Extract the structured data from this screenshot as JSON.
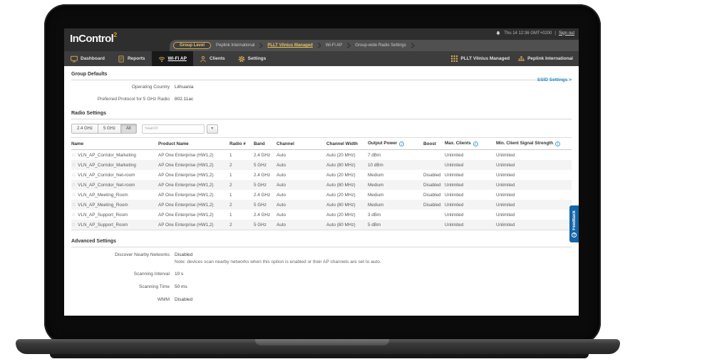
{
  "colors": {
    "accent_gold": "#d2a94f",
    "breadcrumb_active": "#e3c45c",
    "logo_sup_orange": "#e8941f",
    "link_blue": "#1e88c7",
    "info_blue": "#42a5d6",
    "feedback_blue": "#1565a8",
    "header_bg": "#2e2e2e",
    "nav_bg": "#3d3d3d",
    "nav_active_bg": "#191919",
    "row_stripe": "#f4f4f4"
  },
  "icons": {
    "star": "☆",
    "caret_down": "▾",
    "info": "i",
    "feedback": "?"
  },
  "header": {
    "logo_text": "InControl",
    "logo_sup": "2",
    "status": {
      "time": "Thu 14 12:36 GMT+0200",
      "separator": "|",
      "sign_out": "Sign out"
    },
    "breadcrumb": {
      "group_level_label": "Group Level",
      "items": [
        {
          "label": "Peplink International",
          "active": false
        },
        {
          "label": "PLLT Vilnius Managed",
          "active": true
        },
        {
          "label": "Wi-Fi AP",
          "active": false
        },
        {
          "label": "Group-wide Radio Settings",
          "active": false
        }
      ]
    },
    "nav": {
      "items": [
        {
          "icon": "dashboard-icon",
          "label": "Dashboard",
          "active": false
        },
        {
          "icon": "reports-icon",
          "label": "Reports",
          "active": false
        },
        {
          "icon": "wifi-icon",
          "label": "Wi-Fi AP",
          "active": true
        },
        {
          "icon": "clients-icon",
          "label": "Clients",
          "active": false
        },
        {
          "icon": "settings-icon",
          "label": "Settings",
          "active": false
        }
      ],
      "context": [
        {
          "icon": "grid-icon",
          "label": "PLLT Vilnius Managed"
        },
        {
          "icon": "org-icon",
          "label": "Peplink International"
        }
      ]
    }
  },
  "main": {
    "ssid_settings_link": "SSID Settings >",
    "group_defaults": {
      "title": "Group Defaults",
      "fields": [
        {
          "label": "Operating Country",
          "value": "Lithuania"
        },
        {
          "label": "Preferred Protocol for 5 GHz Radio",
          "value": "802.11ac"
        }
      ]
    },
    "radio_settings": {
      "title": "Radio Settings",
      "band_tabs": [
        {
          "label": "2.4 GHz",
          "active": false
        },
        {
          "label": "5 GHz",
          "active": false
        },
        {
          "label": "All",
          "active": true
        }
      ],
      "search_placeholder": "Search",
      "table": {
        "columns": [
          {
            "label": "Name",
            "info": false
          },
          {
            "label": "Product Name",
            "info": false
          },
          {
            "label": "Radio #",
            "info": false
          },
          {
            "label": "Band",
            "info": false
          },
          {
            "label": "Channel",
            "info": false
          },
          {
            "label": "Channel Width",
            "info": false
          },
          {
            "label": "Output Power",
            "info": true
          },
          {
            "label": "Boost",
            "info": false
          },
          {
            "label": "Max. Clients",
            "info": true
          },
          {
            "label": "Min. Client Signal Strength",
            "info": true
          }
        ],
        "rows": [
          {
            "cells": [
              "VLN_AP_Corridor_Marketing",
              "AP One Enterprise (HW1,2)",
              "1",
              "2.4 GHz",
              "Auto",
              "Auto (20 MHz)",
              "7 dBm",
              "",
              "Unlimited",
              "Unlimited"
            ]
          },
          {
            "cells": [
              "VLN_AP_Corridor_Marketing",
              "AP One Enterprise (HW1,2)",
              "2",
              "5 GHz",
              "Auto",
              "Auto (80 MHz)",
              "10 dBm",
              "",
              "Unlimited",
              "Unlimited"
            ]
          },
          {
            "cells": [
              "VLN_AP_Corridor_Net-room",
              "AP One Enterprise (HW1,2)",
              "1",
              "2.4 GHz",
              "Auto",
              "Auto (20 MHz)",
              "Medium",
              "Disabled",
              "Unlimited",
              "Unlimited"
            ]
          },
          {
            "cells": [
              "VLN_AP_Corridor_Net-room",
              "AP One Enterprise (HW1,2)",
              "2",
              "5 GHz",
              "Auto",
              "Auto (80 MHz)",
              "Medium",
              "Disabled",
              "Unlimited",
              "Unlimited"
            ]
          },
          {
            "cells": [
              "VLN_AP_Meeting_Room",
              "AP One Enterprise (HW1,2)",
              "1",
              "2.4 GHz",
              "Auto",
              "Auto (20 MHz)",
              "Medium",
              "Disabled",
              "Unlimited",
              "Unlimited"
            ]
          },
          {
            "cells": [
              "VLN_AP_Meeting_Room",
              "AP One Enterprise (HW1,2)",
              "2",
              "5 GHz",
              "Auto",
              "Auto (80 MHz)",
              "Medium",
              "Disabled",
              "Unlimited",
              "Unlimited"
            ]
          },
          {
            "cells": [
              "VLN_AP_Support_Room",
              "AP One Enterprise (HW1,2)",
              "1",
              "2.4 GHz",
              "Auto",
              "Auto (20 MHz)",
              "3 dBm",
              "",
              "Unlimited",
              "Unlimited"
            ]
          },
          {
            "cells": [
              "VLN_AP_Support_Room",
              "AP One Enterprise (HW1,2)",
              "2",
              "5 GHz",
              "Auto",
              "Auto (80 MHz)",
              "5 dBm",
              "",
              "Unlimited",
              "Unlimited"
            ]
          }
        ]
      }
    },
    "advanced_settings": {
      "title": "Advanced Settings",
      "fields": [
        {
          "label": "Discover Nearby Networks",
          "value": "Disabled",
          "note": "Note: devices scan nearby networks when this option is enabled or their AP channels are set to auto."
        },
        {
          "label": "Scanning Interval",
          "value": "10 s"
        },
        {
          "label": "Scanning Time",
          "value": "50 ms"
        },
        {
          "label": "WMM",
          "value": "Disabled"
        }
      ]
    },
    "feedback_tab": {
      "label": "Feedback"
    }
  }
}
